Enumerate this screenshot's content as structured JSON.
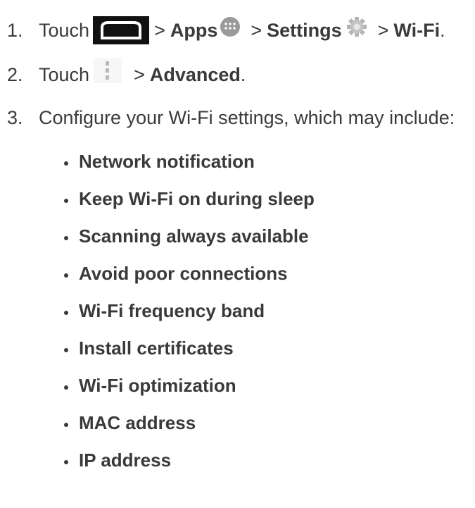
{
  "steps": [
    {
      "number": "1.",
      "text": "Touch",
      "separator": ">",
      "apps": "Apps",
      "settings": "Settings",
      "wifi": "Wi-Fi",
      "end": "."
    },
    {
      "number": "2.",
      "text": "Touch",
      "separator": ">",
      "advanced": "Advanced",
      "end": "."
    },
    {
      "number": "3.",
      "text": "Configure your Wi-Fi settings, which may include:"
    }
  ],
  "icons": {
    "home": "home-icon",
    "apps": "apps-icon",
    "settings": "gear-icon",
    "menu": "overflow-menu-icon"
  },
  "settings_list": [
    "Network notification",
    "Keep Wi-Fi on during sleep",
    "Scanning always available",
    "Avoid poor connections",
    "Wi-Fi frequency band",
    "Install certificates",
    "Wi-Fi optimization",
    "MAC address",
    "IP address"
  ],
  "colors": {
    "text": "#3a3a3a",
    "home_button_bg": "#111111",
    "icon_gray": "#9a9a9a"
  }
}
